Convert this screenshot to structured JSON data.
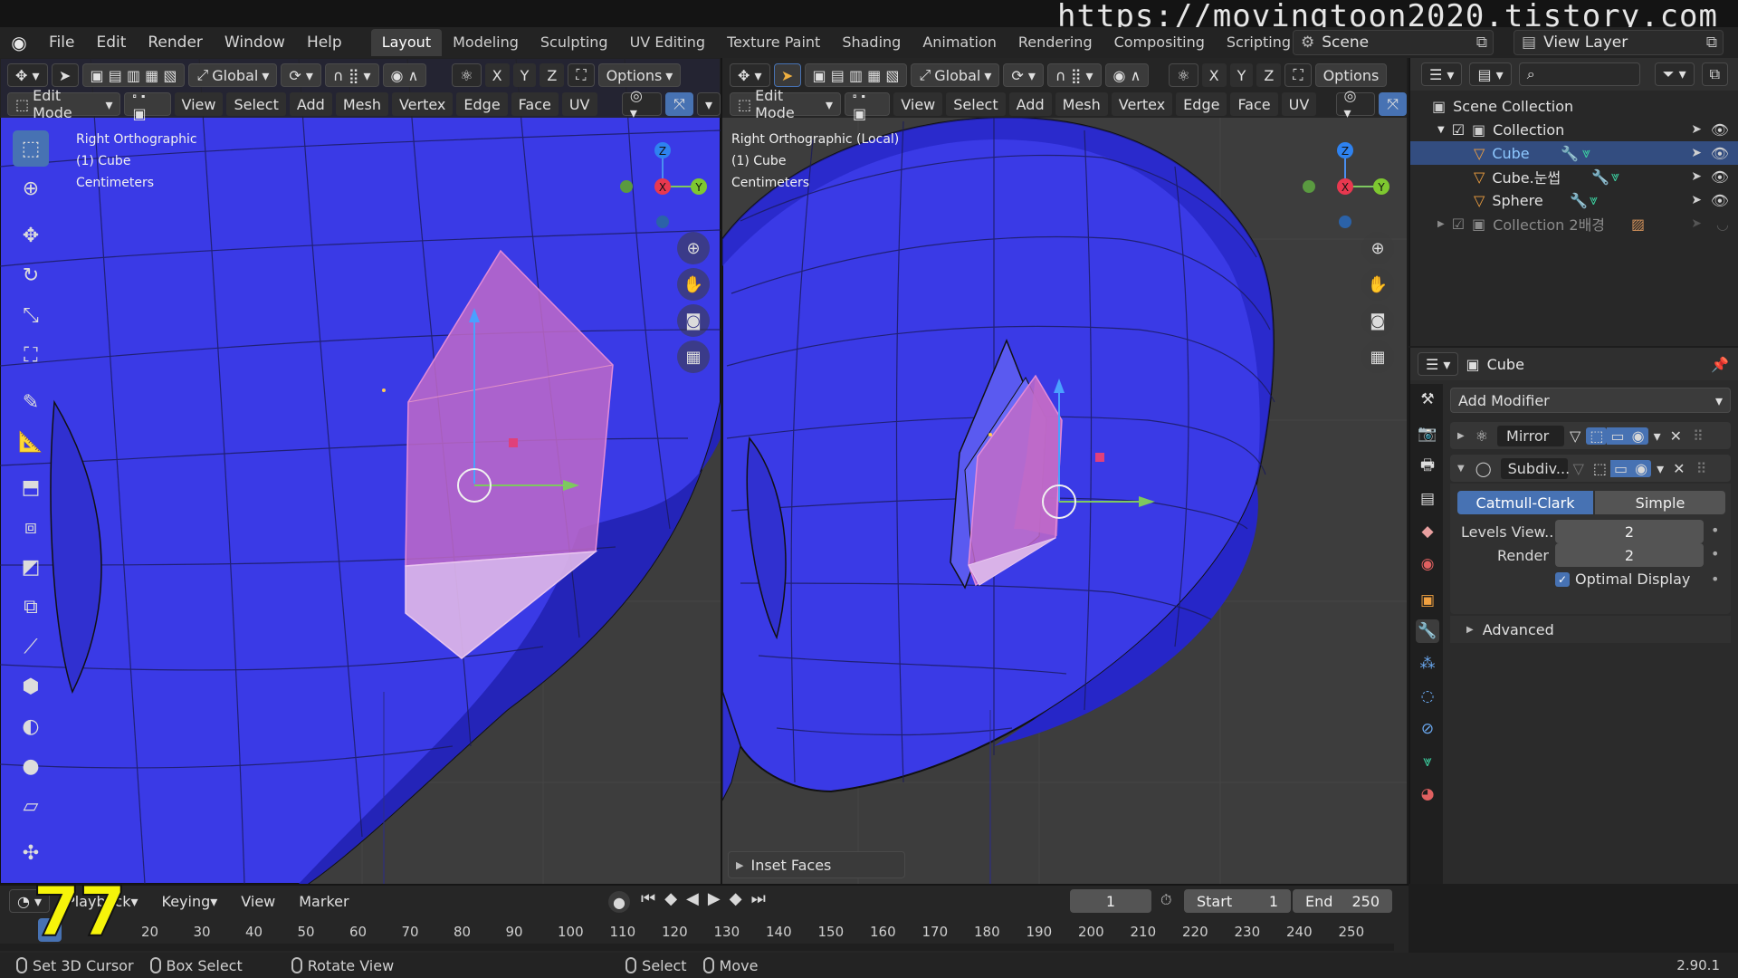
{
  "overlay": {
    "url": "https://movingtoon2020.tistory.com",
    "episode": "77"
  },
  "menu": {
    "items": [
      "File",
      "Edit",
      "Render",
      "Window",
      "Help"
    ]
  },
  "workspaces": [
    "Layout",
    "Modeling",
    "Sculpting",
    "UV Editing",
    "Texture Paint",
    "Shading",
    "Animation",
    "Rendering",
    "Compositing",
    "Scripting"
  ],
  "workspace_active": "Layout",
  "scene": {
    "label": "Scene",
    "view_layer": "View Layer"
  },
  "viewport_left": {
    "header": {
      "orientation": "Global",
      "options": "Options",
      "mode": "Edit Mode",
      "axes": [
        "X",
        "Y",
        "Z"
      ],
      "menus": [
        "View",
        "Select",
        "Add",
        "Mesh",
        "Vertex",
        "Edge",
        "Face",
        "UV"
      ]
    },
    "info": [
      "Right Orthographic",
      "(1) Cube",
      "Centimeters"
    ]
  },
  "viewport_right": {
    "header": {
      "orientation": "Global",
      "options": "Options",
      "mode": "Edit Mode",
      "axes": [
        "X",
        "Y",
        "Z"
      ],
      "menus": [
        "View",
        "Select",
        "Add",
        "Mesh",
        "Vertex",
        "Edge",
        "Face",
        "UV"
      ]
    },
    "info": [
      "Right Orthographic (Local)",
      "(1) Cube",
      "Centimeters"
    ],
    "operator_panel": "Inset Faces"
  },
  "gizmo": {
    "x": "X",
    "y": "Y",
    "z": "Z"
  },
  "outliner": {
    "root": "Scene Collection",
    "items": [
      {
        "label": "Collection",
        "type": "collection"
      },
      {
        "label": "Cube",
        "type": "mesh",
        "selected": true
      },
      {
        "label": "Cube.눈썹",
        "type": "mesh"
      },
      {
        "label": "Sphere",
        "type": "mesh"
      },
      {
        "label": "Collection 2배경",
        "type": "collection",
        "disabled": true
      }
    ]
  },
  "properties": {
    "object": "Cube",
    "add_modifier": "Add Modifier",
    "modifiers": [
      {
        "name": "Mirror",
        "expanded": false
      },
      {
        "name": "Subdiv...",
        "expanded": true
      }
    ],
    "subdiv": {
      "types": [
        "Catmull-Clark",
        "Simple"
      ],
      "active_type": "Catmull-Clark",
      "levels_view_label": "Levels View...",
      "levels_view": "2",
      "render_label": "Render",
      "render": "2",
      "optimal_display": "Optimal Display",
      "advanced": "Advanced"
    }
  },
  "timeline": {
    "menus": [
      "Playback",
      "Keying",
      "View",
      "Marker"
    ],
    "current_frame": "1",
    "start_label": "Start",
    "start": "1",
    "end_label": "End",
    "end": "250",
    "ticks": [
      "20",
      "30",
      "40",
      "50",
      "60",
      "70",
      "80",
      "90",
      "100",
      "110",
      "120",
      "130",
      "140",
      "150",
      "160",
      "170",
      "180",
      "190",
      "200",
      "210",
      "220",
      "230",
      "240",
      "250"
    ]
  },
  "statusbar": {
    "items": [
      "Set 3D Cursor",
      "Box Select",
      "Rotate View",
      "Select",
      "Move"
    ],
    "version": "2.90.1"
  },
  "colors": {
    "accent": "#4772b3",
    "mesh": "#3b3be8",
    "selection": "#c86ac0",
    "episode": "#f6f40a"
  }
}
